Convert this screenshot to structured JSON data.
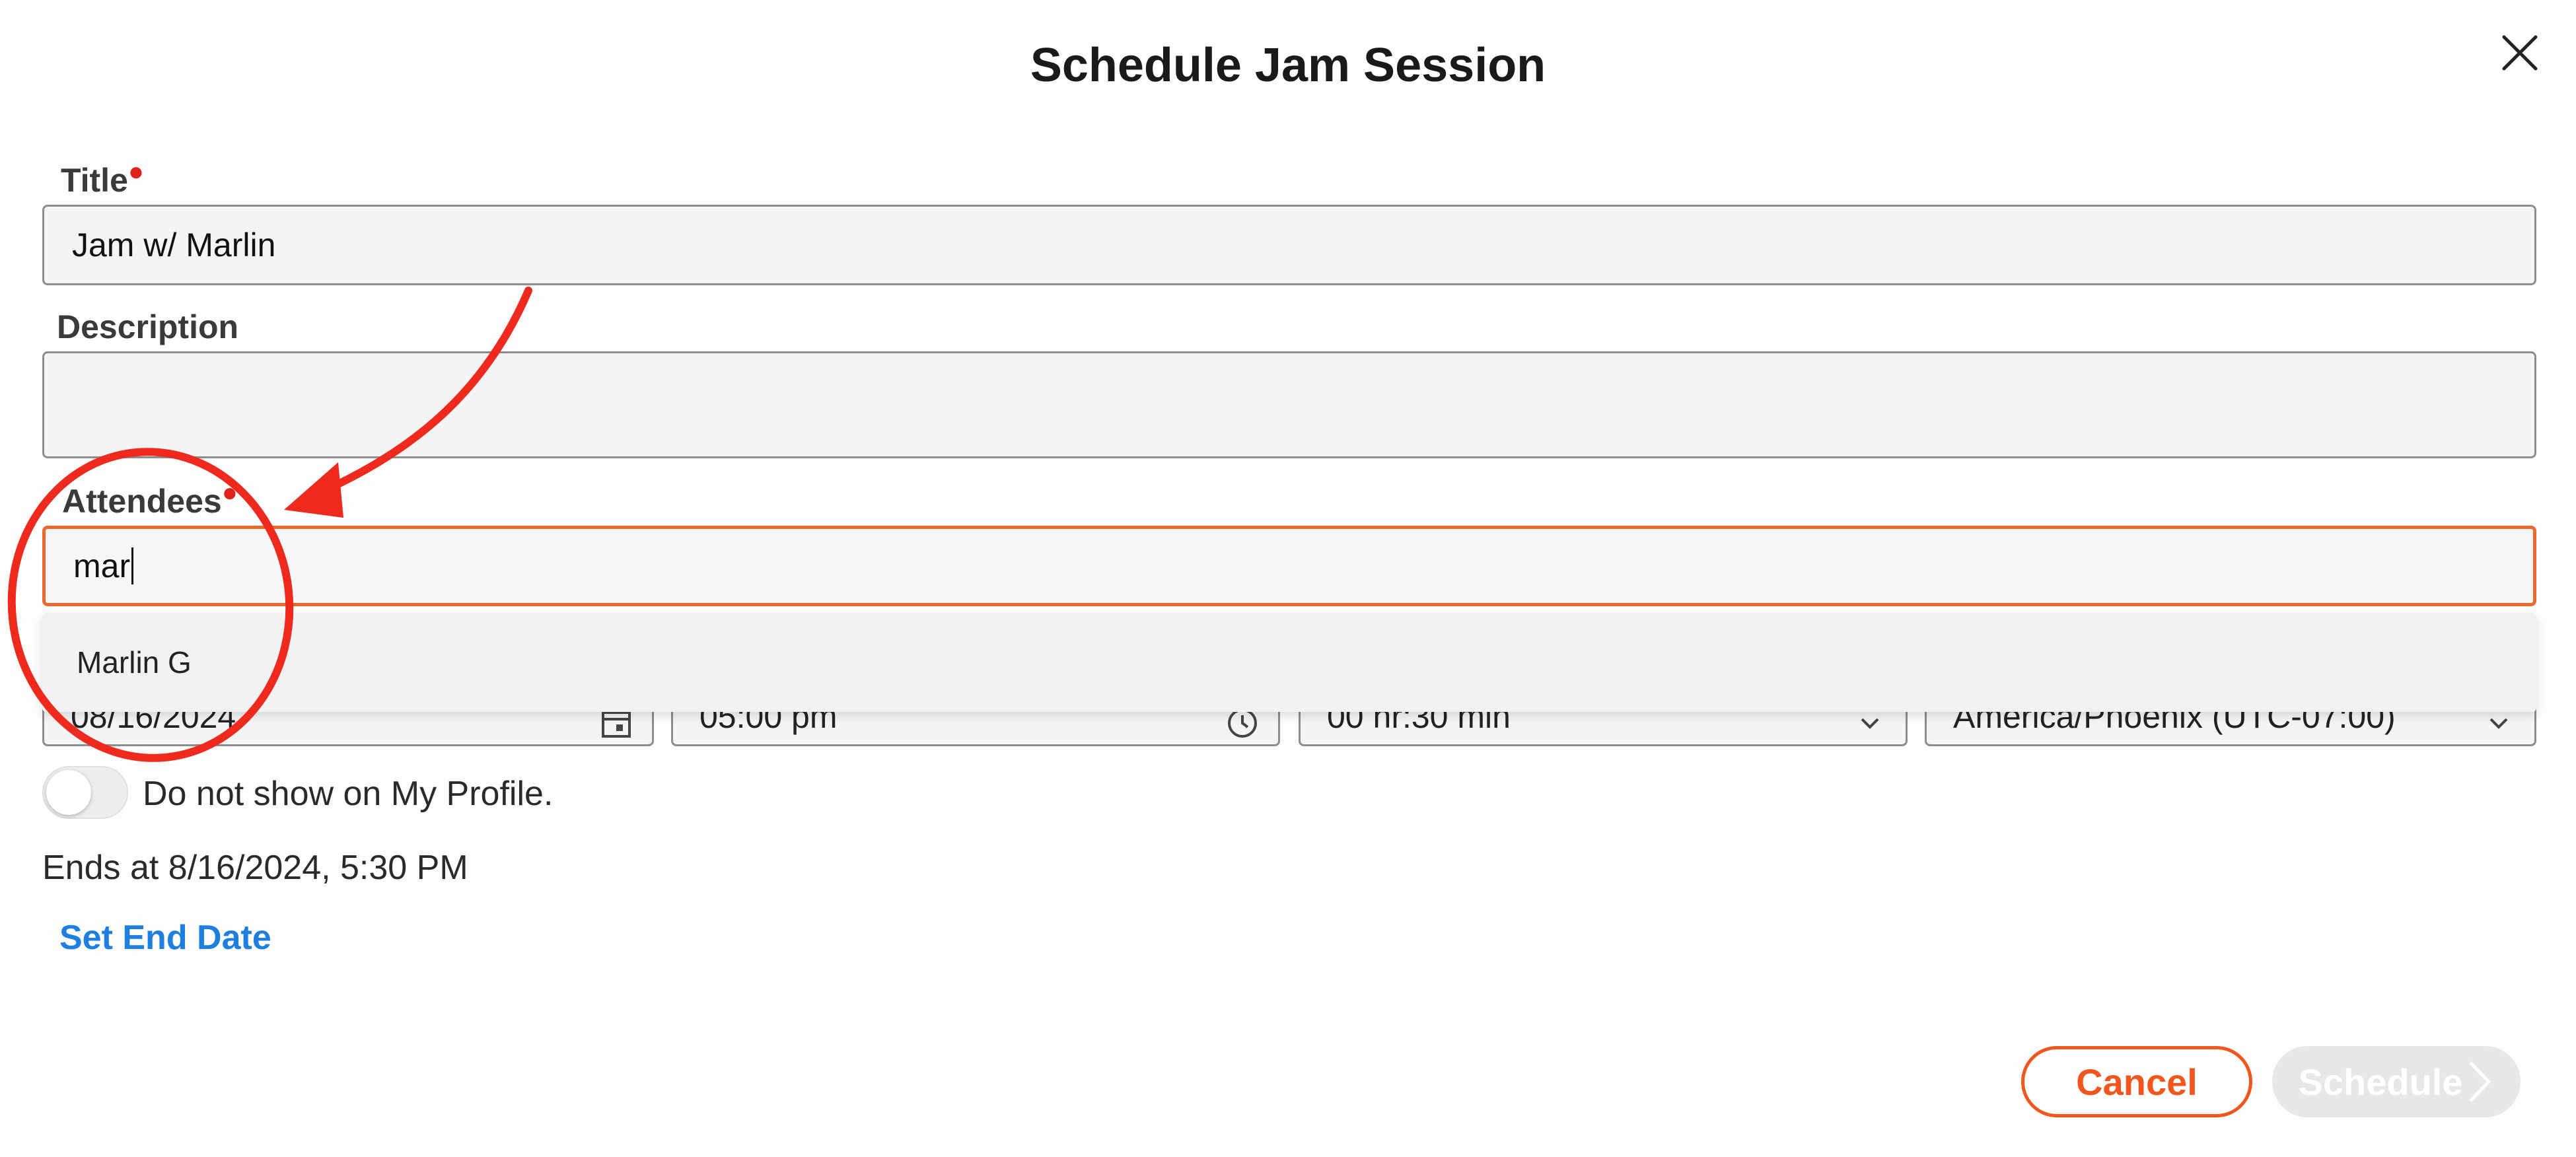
{
  "dialog": {
    "title": "Schedule Jam Session",
    "close_icon": "close-icon"
  },
  "form": {
    "title": {
      "label": "Title",
      "required": true,
      "value": "Jam w/ Marlin"
    },
    "description": {
      "label": "Description",
      "value": ""
    },
    "attendees": {
      "label": "Attendees",
      "required": true,
      "value": "mar",
      "suggestions": [
        "Marlin G"
      ]
    },
    "date": {
      "value": "08/16/2024",
      "icon": "calendar-icon"
    },
    "time": {
      "value": "05:00 pm",
      "icon": "clock-icon"
    },
    "duration": {
      "value": "00 hr:30 min",
      "icon": "chevron-down-icon"
    },
    "timezone": {
      "value": "America/Phoenix (UTC-07:00)",
      "icon": "chevron-down-icon"
    },
    "hide_profile": {
      "label": "Do not show on My Profile.",
      "enabled": false
    },
    "ends_at": "Ends at 8/16/2024, 5:30 PM",
    "set_end_date": "Set End Date"
  },
  "actions": {
    "cancel": "Cancel",
    "schedule": "Schedule"
  },
  "colors": {
    "accent": "#f0561d",
    "focus_border": "#ec6a2b",
    "link": "#1f7fe0",
    "required": "#e0201b",
    "annotation": "#ee2a1e",
    "disabled_button": "#e7e7e7"
  }
}
